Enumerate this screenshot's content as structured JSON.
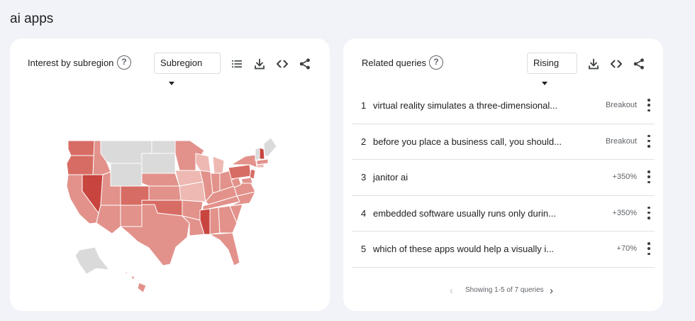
{
  "page": {
    "title": "ai apps"
  },
  "subregion_card": {
    "title": "Interest by subregion",
    "help": "?",
    "select_value": "Subregion",
    "map_colors": {
      "none": "#dadada",
      "low": "#eeb8b3",
      "mid": "#e2928b",
      "high": "#d76c64",
      "top": "#c8443f"
    }
  },
  "queries_card": {
    "title": "Related queries",
    "help": "?",
    "select_value": "Rising",
    "rows": [
      {
        "index": "1",
        "text": "virtual reality simulates a three-dimensional...",
        "value": "Breakout"
      },
      {
        "index": "2",
        "text": "before you place a business call, you should...",
        "value": "Breakout"
      },
      {
        "index": "3",
        "text": "janitor ai",
        "value": "+350%"
      },
      {
        "index": "4",
        "text": "embedded software usually runs only durin...",
        "value": "+350%"
      },
      {
        "index": "5",
        "text": "which of these apps would help a visually i...",
        "value": "+70%"
      }
    ],
    "pager": {
      "prev": "‹",
      "text": "Showing 1-5 of 7 queries",
      "next": "›"
    }
  },
  "icons": {
    "list": "list-icon",
    "download": "download-icon",
    "embed": "embed-code-icon",
    "share": "share-icon",
    "more": "more-vert-icon"
  }
}
